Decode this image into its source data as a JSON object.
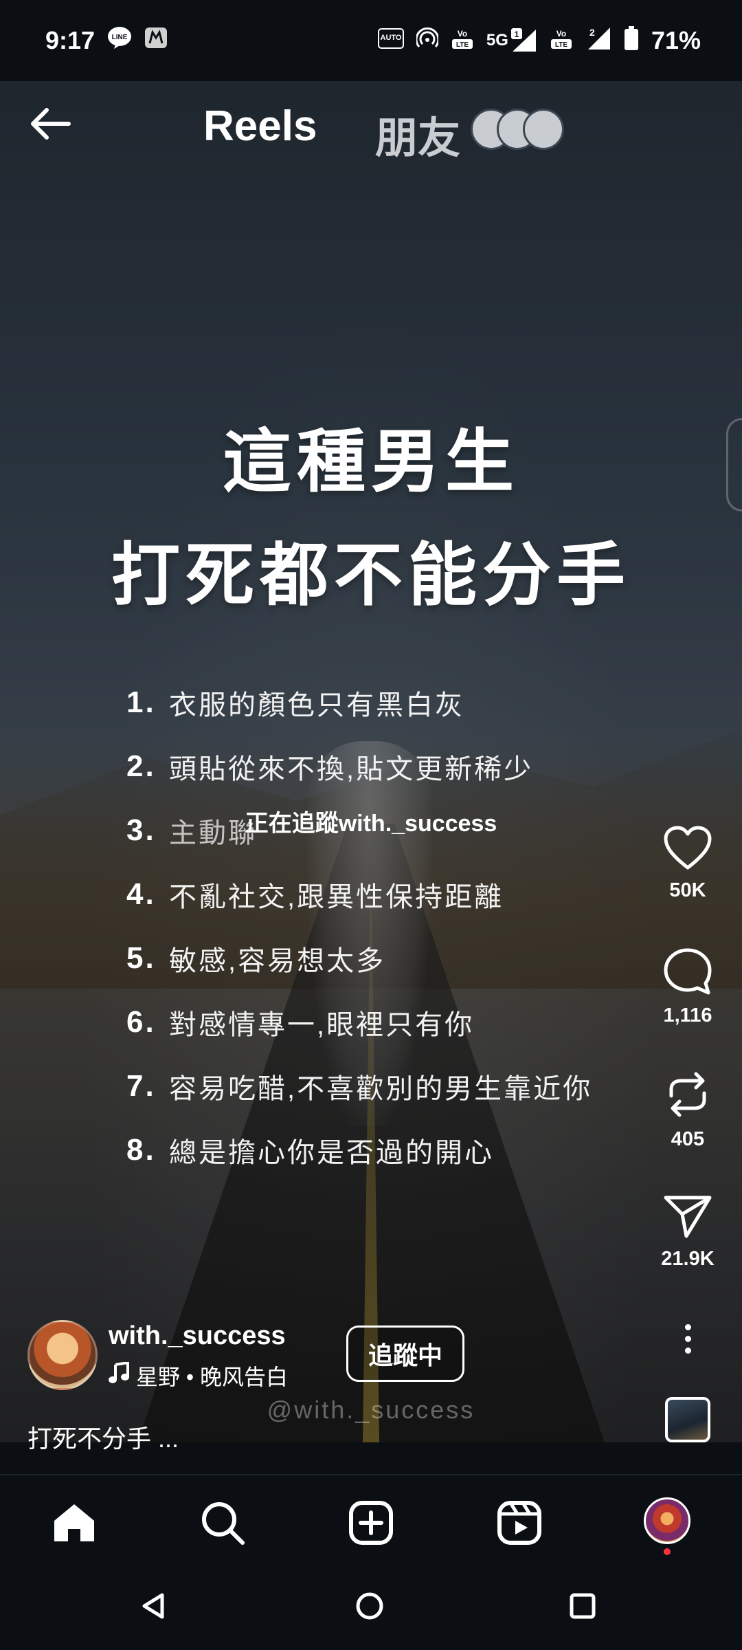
{
  "status_bar": {
    "time": "9:17",
    "left_icons": [
      "line-app-icon",
      "mi-app-icon"
    ],
    "right_icons": [
      "auto-hz-icon",
      "hotspot-icon",
      "volte-icon",
      "5g-signal-icon",
      "volte-icon-2",
      "signal-2-icon",
      "battery-icon"
    ],
    "auto_label": "AUTO",
    "network_label": "5G",
    "sim1_label": "1",
    "sim2_label": "2",
    "battery": "71%"
  },
  "header": {
    "tab_reels": "Reels",
    "tab_friends": "朋友"
  },
  "video": {
    "headline_1": "這種男生",
    "headline_2": "打死都不能分手",
    "list": [
      {
        "num": "1.",
        "text": "衣服的顏色只有黑白灰"
      },
      {
        "num": "2.",
        "text": "頭貼從來不換,貼文更新稀少"
      },
      {
        "num": "3.",
        "text": "主動聯"
      },
      {
        "num": "4.",
        "text": "不亂社交,跟異性保持距離"
      },
      {
        "num": "5.",
        "text": "敏感,容易想太多"
      },
      {
        "num": "6.",
        "text": "對感情專一,眼裡只有你"
      },
      {
        "num": "7.",
        "text": "容易吃醋,不喜歡別的男生靠近你"
      },
      {
        "num": "8.",
        "text": "總是擔心你是否過的開心"
      }
    ],
    "follow_overlay": "正在追蹤with._success",
    "watermark": "@with._success"
  },
  "actions": {
    "likes": "50K",
    "comments": "1,116",
    "reposts": "405",
    "shares": "21.9K"
  },
  "author": {
    "username": "with._success",
    "music": "星野 • 晚风告白",
    "follow_label": "追蹤中",
    "caption": "打死不分手 ..."
  },
  "colors": {
    "background": "#0b0f14",
    "notification_dot": "#ff3040"
  }
}
